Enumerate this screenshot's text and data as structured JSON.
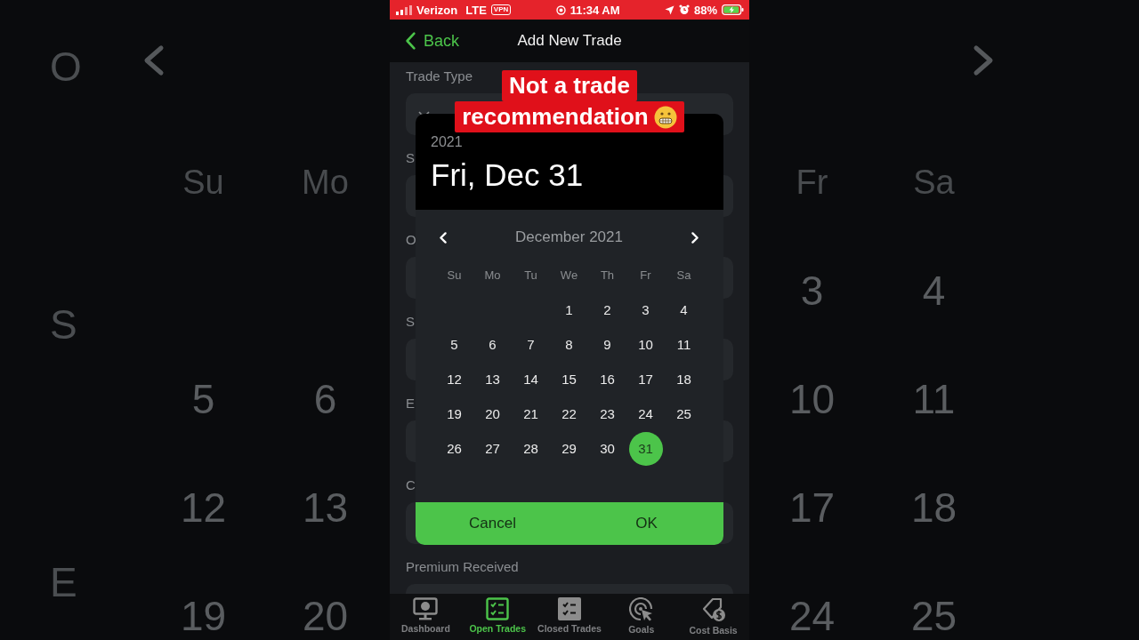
{
  "backdrop": [
    {
      "kind": "left",
      "labels": [
        "O",
        "S",
        "E"
      ],
      "weekdays": [
        "Su",
        "Mo"
      ],
      "weeks": [
        [
          "5",
          "6"
        ],
        [
          "12",
          "13"
        ],
        [
          "19",
          "20"
        ]
      ]
    },
    {
      "kind": "right",
      "weekdays": [
        "Fr",
        "Sa"
      ],
      "weeks": [
        [
          "3",
          "4"
        ],
        [
          "10",
          "11"
        ],
        [
          "17",
          "18"
        ],
        [
          "24",
          "25"
        ]
      ]
    }
  ],
  "status_bar": {
    "carrier": "Verizon",
    "network": "LTE",
    "vpn": "VPN",
    "time": "11:34 AM",
    "battery": "88%"
  },
  "header": {
    "back": "Back",
    "title": "Add New Trade"
  },
  "form": {
    "fields": [
      {
        "label": "Trade Type",
        "kind": "select"
      },
      {
        "label": "S",
        "kind": "input"
      },
      {
        "label": "O",
        "kind": "input"
      },
      {
        "label": "S",
        "kind": "input"
      },
      {
        "label": "E",
        "kind": "input"
      },
      {
        "label": "C",
        "kind": "input"
      },
      {
        "label": "Premium Received",
        "kind": "input"
      }
    ]
  },
  "caption": {
    "lines": [
      {
        "text": "Not a trade",
        "emoji": false
      },
      {
        "text": "recommendation",
        "emoji": true
      }
    ]
  },
  "date_picker": {
    "year": "2021",
    "date": "Fri, Dec 31",
    "month": "December 2021",
    "weekdays": [
      "Su",
      "Mo",
      "Tu",
      "We",
      "Th",
      "Fr",
      "Sa"
    ],
    "weeks": [
      [
        {
          "label": "1",
          "selected": false
        },
        {
          "label": "2",
          "selected": false
        },
        {
          "label": "3",
          "selected": false
        },
        {
          "label": "4",
          "selected": false
        }
      ],
      [
        {
          "label": "5",
          "selected": false
        },
        {
          "label": "6",
          "selected": false
        },
        {
          "label": "7",
          "selected": false
        },
        {
          "label": "8",
          "selected": false
        },
        {
          "label": "9",
          "selected": false
        },
        {
          "label": "10",
          "selected": false
        },
        {
          "label": "11",
          "selected": false
        }
      ],
      [
        {
          "label": "12",
          "selected": false
        },
        {
          "label": "13",
          "selected": false
        },
        {
          "label": "14",
          "selected": false
        },
        {
          "label": "15",
          "selected": false
        },
        {
          "label": "16",
          "selected": false
        },
        {
          "label": "17",
          "selected": false
        },
        {
          "label": "18",
          "selected": false
        }
      ],
      [
        {
          "label": "19",
          "selected": false
        },
        {
          "label": "20",
          "selected": false
        },
        {
          "label": "21",
          "selected": false
        },
        {
          "label": "22",
          "selected": false
        },
        {
          "label": "23",
          "selected": false
        },
        {
          "label": "24",
          "selected": false
        },
        {
          "label": "25",
          "selected": false
        }
      ],
      [
        {
          "label": "26",
          "selected": false
        },
        {
          "label": "27",
          "selected": false
        },
        {
          "label": "28",
          "selected": false
        },
        {
          "label": "29",
          "selected": false
        },
        {
          "label": "30",
          "selected": false
        },
        {
          "label": "31",
          "selected": true
        }
      ]
    ],
    "buttons": [
      "Cancel",
      "OK"
    ]
  },
  "tab_bar": [
    {
      "label": "Dashboard",
      "kind": "monitor",
      "selected": false
    },
    {
      "label": "Open Trades",
      "kind": "checklist",
      "selected": true
    },
    {
      "label": "Closed Trades",
      "kind": "checklist-filled",
      "selected": false
    },
    {
      "label": "Goals",
      "kind": "target",
      "selected": false
    },
    {
      "label": "Cost Basis",
      "kind": "tag",
      "selected": false
    }
  ]
}
